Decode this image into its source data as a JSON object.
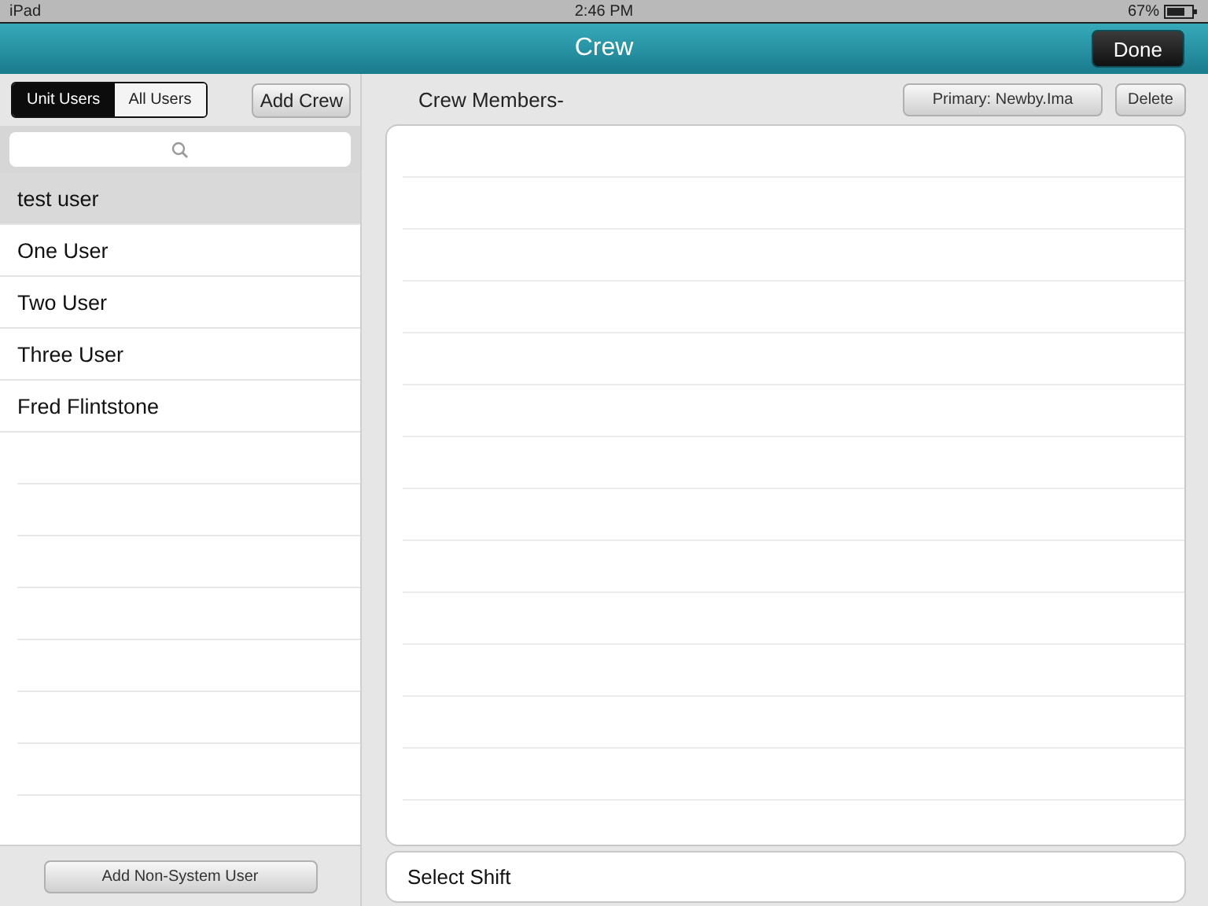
{
  "status_bar": {
    "device": "iPad",
    "time": "2:46 PM",
    "battery": "67%"
  },
  "nav_bar": {
    "title": "Crew",
    "done_button": "Done"
  },
  "segments": [
    {
      "label": "Unit Users",
      "selected": true
    },
    {
      "label": "All Users",
      "selected": false
    }
  ],
  "add_crew_button": "Add Crew",
  "users": [
    {
      "name": "test user",
      "selected": true
    },
    {
      "name": "One User",
      "selected": false
    },
    {
      "name": "Two User",
      "selected": false
    },
    {
      "name": "Three User",
      "selected": false
    },
    {
      "name": "Fred Flintstone",
      "selected": false
    }
  ],
  "add_non_system_user_button": "Add Non-System User",
  "crew_header": {
    "title": "Crew Members-",
    "primary_button": "Primary: Newby.Ima",
    "delete_button": "Delete"
  },
  "select_shift": "Select Shift"
}
